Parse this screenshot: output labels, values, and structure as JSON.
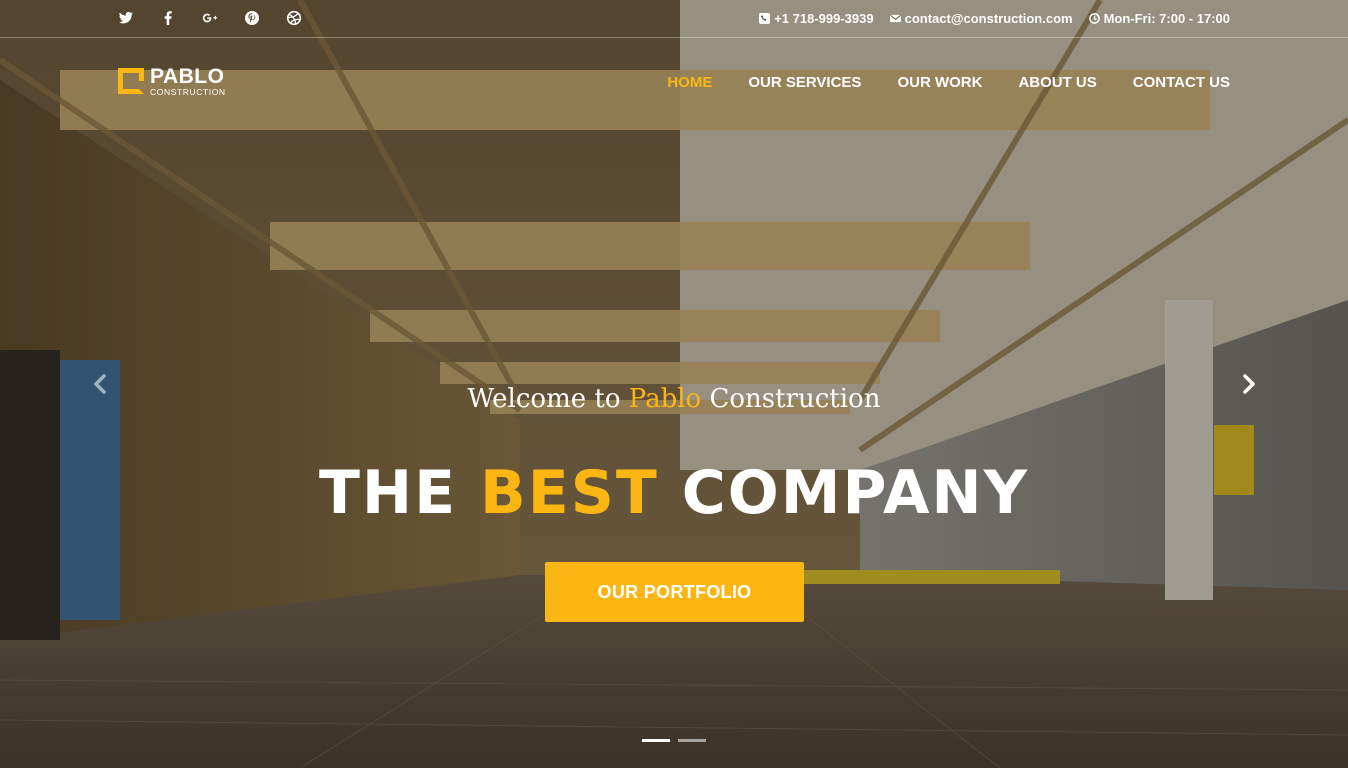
{
  "colors": {
    "accent": "#fbb614",
    "text": "#ffffff"
  },
  "topbar": {
    "social_icons": [
      "twitter-icon",
      "facebook-icon",
      "google-plus-icon",
      "pinterest-icon",
      "dribbble-icon"
    ],
    "phone": "+1 718-999-3939",
    "email": "contact@construction.com",
    "hours": "Mon-Fri: 7:00 - 17:00"
  },
  "logo": {
    "name": "PABLO",
    "subtitle": "CONSTRUCTION"
  },
  "nav": {
    "items": [
      {
        "label": "HOME",
        "active": true
      },
      {
        "label": "OUR SERVICES",
        "active": false
      },
      {
        "label": "OUR WORK",
        "active": false
      },
      {
        "label": "ABOUT US",
        "active": false
      },
      {
        "label": "CONTACT US",
        "active": false
      }
    ]
  },
  "hero": {
    "welcome_prefix": "Welcome to",
    "welcome_brand": "Pablo",
    "welcome_suffix": "Construction",
    "headline_part1": "THE",
    "headline_accent": "BEST",
    "headline_part2": "COMPANY",
    "cta_label": "OUR PORTFOLIO",
    "slides_total": 2,
    "active_slide": 1
  }
}
